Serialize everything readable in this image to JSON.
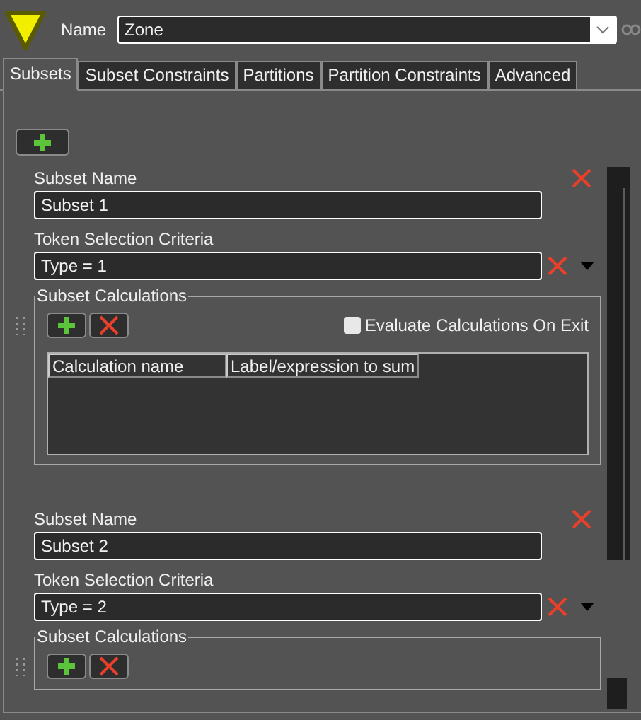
{
  "header": {
    "name_label": "Name",
    "name_value": "Zone"
  },
  "tabs": [
    {
      "label": "Subsets",
      "selected": true
    },
    {
      "label": "Subset Constraints",
      "selected": false
    },
    {
      "label": "Partitions",
      "selected": false
    },
    {
      "label": "Partition Constraints",
      "selected": false
    },
    {
      "label": "Advanced",
      "selected": false
    }
  ],
  "subsets": [
    {
      "name_label": "Subset Name",
      "name_value": "Subset 1",
      "criteria_label": "Token Selection Criteria",
      "criteria_value": "Type = 1",
      "calc_title": "Subset Calculations",
      "evaluate_label": "Evaluate Calculations On Exit",
      "evaluate_checked": false,
      "columns": [
        "Calculation name",
        "Label/expression to sum"
      ]
    },
    {
      "name_label": "Subset Name",
      "name_value": "Subset 2",
      "criteria_label": "Token Selection Criteria",
      "criteria_value": "Type = 2",
      "calc_title": "Subset Calculations"
    }
  ]
}
